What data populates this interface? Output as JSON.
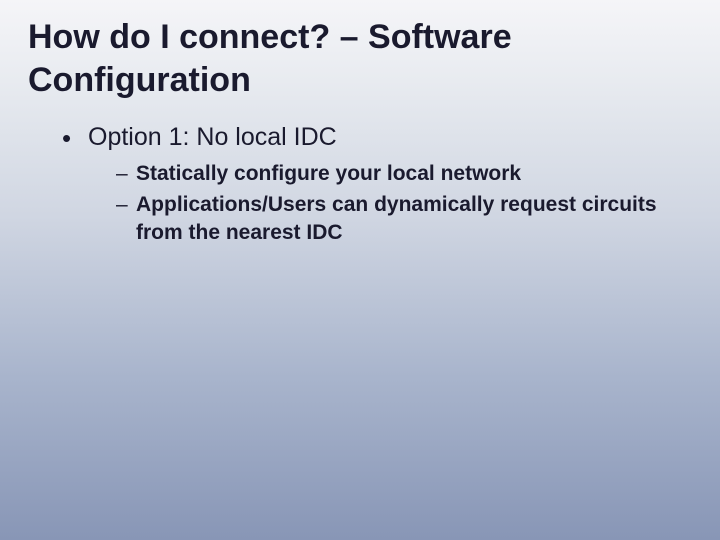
{
  "slide": {
    "title": "How do I connect? – Software Configuration",
    "bullets": [
      {
        "text": "Option 1: No local IDC",
        "sub": [
          "Statically configure your local network",
          "Applications/Users can dynamically request circuits from the nearest IDC"
        ]
      }
    ]
  }
}
